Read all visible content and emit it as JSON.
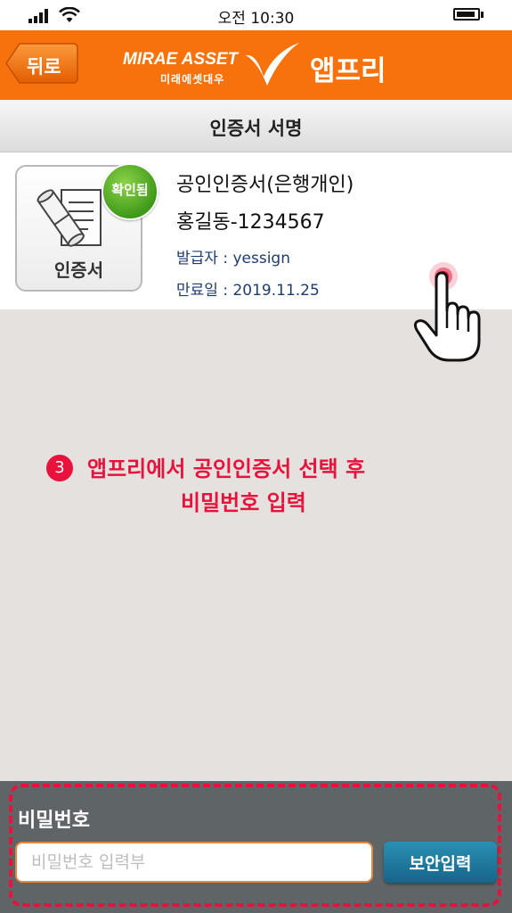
{
  "status_bar": {
    "time": "오전 10:30",
    "icons": [
      "signal-icon",
      "wifi-icon",
      "battery-icon"
    ]
  },
  "header": {
    "back_label": "뒤로",
    "brand_en": "MIRAE ASSET",
    "brand_ko": "미래에셋대우",
    "app_name": "앱프리",
    "accent_color": "#f7720c"
  },
  "page": {
    "title": "인증서 서명"
  },
  "certificate": {
    "icon_label": "인증서",
    "badge": "확인됨",
    "name": "공인인증서(은행개인)",
    "holder": "홍길동-1234567",
    "issuer": "발급자 : yessign",
    "expiry": "만료일 : 2019.11.25"
  },
  "instruction": {
    "step": "3",
    "line1": "앱프리에서 공인인증서 선택 후",
    "line2": "비밀번호 입력",
    "highlight_color": "#e8123c"
  },
  "password": {
    "label": "비밀번호",
    "placeholder": "비밀번호 입력부",
    "value": "",
    "secure_button_label": "보안입력",
    "button_color": "#1f7ea3"
  }
}
